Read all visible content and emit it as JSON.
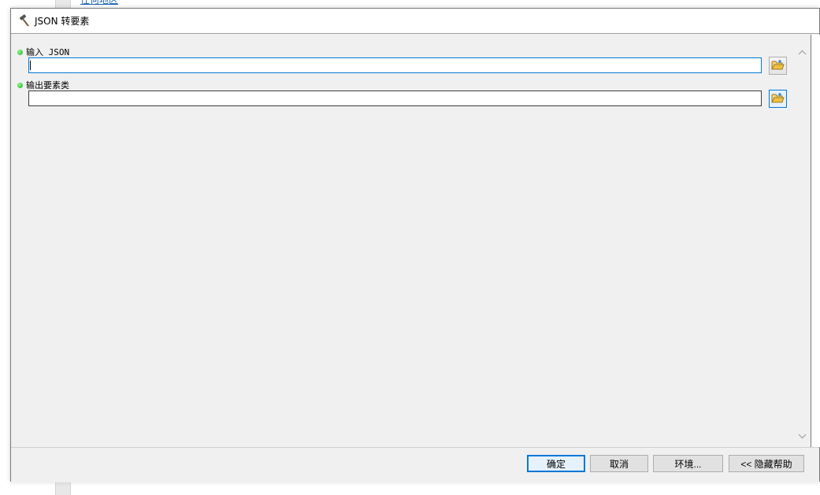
{
  "background": {
    "link_text": "任何地区"
  },
  "dialog": {
    "title": "JSON 转要素",
    "icons": {
      "title_icon": "hammer-icon",
      "browse_icon": "open-folder-icon",
      "required_icon": "green-dot-icon",
      "scroll_up": "chevron-up-icon",
      "scroll_down": "chevron-down-icon"
    },
    "params": [
      {
        "label": "输入 JSON",
        "value": "",
        "required": true
      },
      {
        "label": "输出要素类",
        "value": "",
        "required": true
      }
    ],
    "buttons": {
      "ok": "确定",
      "cancel": "取消",
      "environments": "环境...",
      "hide_help": "<< 隐藏帮助"
    },
    "colors": {
      "accent": "#0078d7",
      "required_dot": "#1cb51c",
      "folder": "#f0c040"
    }
  }
}
